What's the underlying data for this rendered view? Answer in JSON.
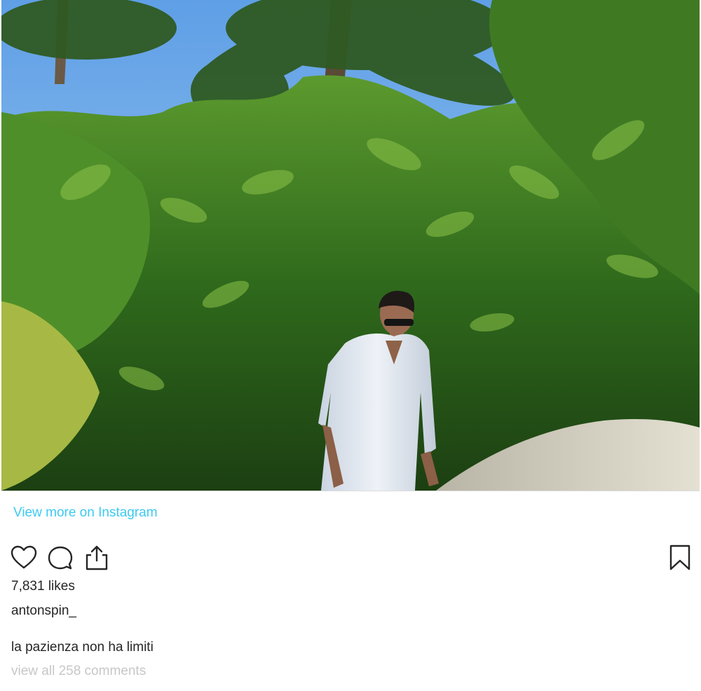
{
  "post": {
    "image_alt": "Man in a white linen shirt walking on a sandy path among tropical bushes and palm trees",
    "view_more_link": "View more on Instagram",
    "likes": "7,831 likes",
    "username": "antonspin_",
    "caption": "la pazienza non ha limiti",
    "comments_link": "view all 258 comments"
  },
  "actions": {
    "like_icon": "heart-icon",
    "comment_icon": "comment-bubble-icon",
    "share_icon": "share-icon",
    "save_icon": "bookmark-icon"
  },
  "colors": {
    "link": "#3ccaf0",
    "text": "#262626",
    "muted": "#c7c7c7"
  }
}
